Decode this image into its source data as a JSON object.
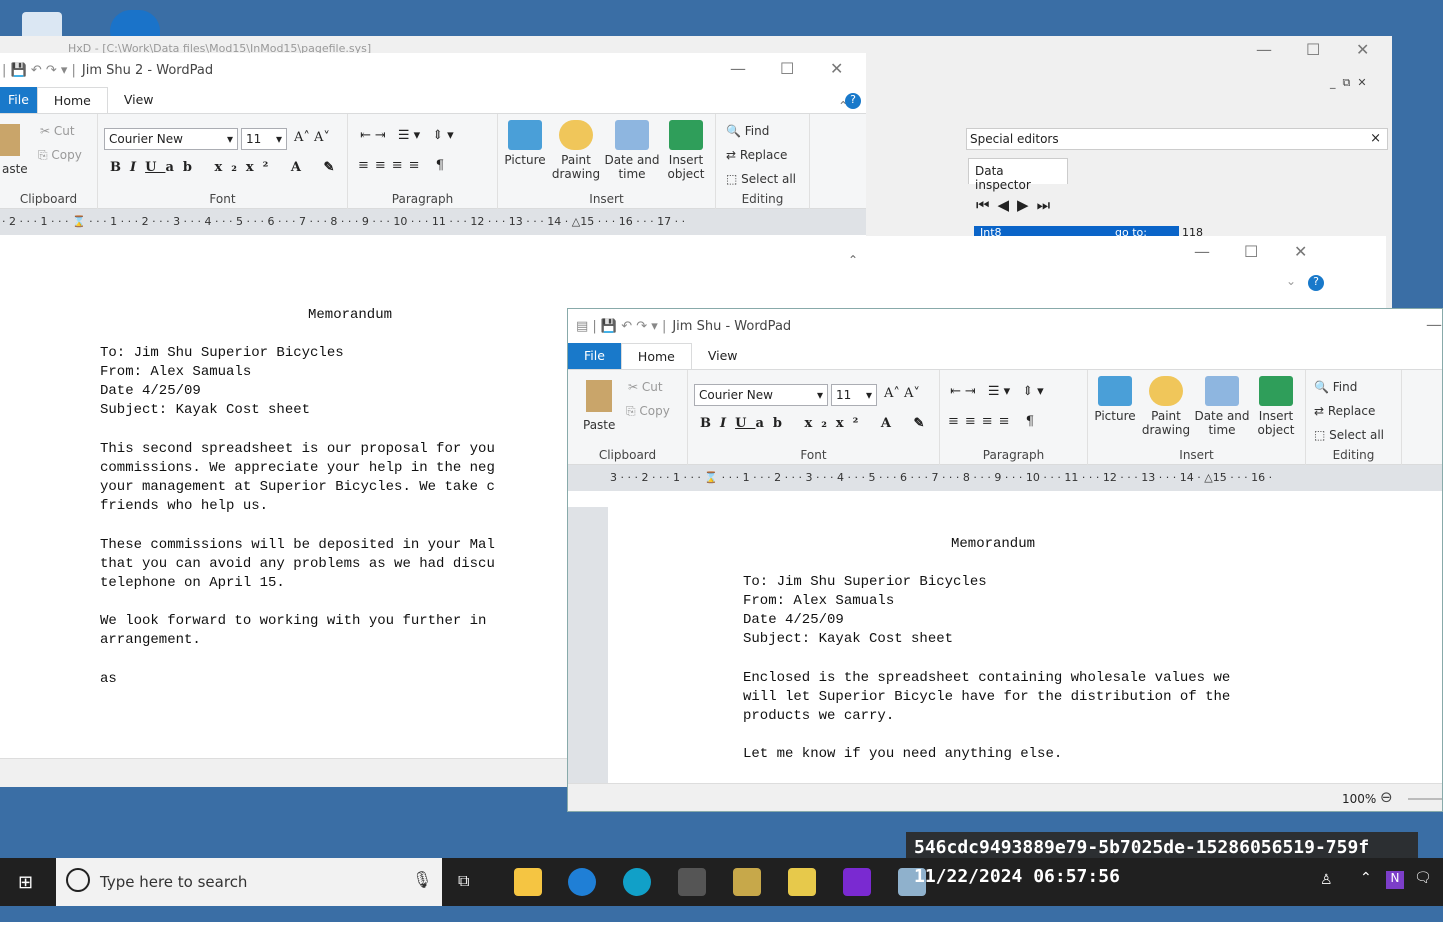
{
  "desktop": {
    "recycle_bin": "Recycle Bin"
  },
  "hxd": {
    "title": "HxD - [C:\\Work\\Data files\\Mod15\\InMod15\\pagefile.sys]",
    "special_editors": "Special editors",
    "data_inspector": "Data inspector",
    "inspector_type": "Int8",
    "inspector_goto": "go to:",
    "inspector_value": "118"
  },
  "wp_back": {
    "title": "Jim Shu 2 - WordPad",
    "tabs": [
      "File",
      "Home",
      "View"
    ],
    "clipboard": {
      "paste": "aste",
      "cut": "Cut",
      "copy": "Copy",
      "label": "Clipboard"
    },
    "font": {
      "name": "Courier New",
      "size": "11",
      "label": "Font"
    },
    "paragraph": {
      "label": "Paragraph"
    },
    "insert": {
      "picture": "Picture",
      "paint": "Paint\ndrawing",
      "datetime": "Date and\ntime",
      "object": "Insert\nobject",
      "label": "Insert"
    },
    "editing": {
      "find": "Find",
      "replace": "Replace",
      "selectall": "Select all",
      "label": "Editing"
    },
    "ruler": "· 2 · · · 1 · · · ⌛ · · · 1 · · · 2 · · · 3 · · · 4 · · · 5 · · · 6 · · · 7 · · · 8 · · · 9 · · · 10 · · · 11 · · · 12 · · · 13 · · · 14 · △15 · · · 16 · · · 17 · ·",
    "doc": {
      "heading": "Memorandum",
      "to": "To: Jim Shu Superior Bicycles",
      "from": "From: Alex Samuals",
      "date": "Date 4/25/09",
      "subject": "Subject: Kayak Cost sheet",
      "p1": "This second spreadsheet is our proposal for you\ncommissions. We appreciate your help in the neg\nyour management at Superior Bicycles. We take c\nfriends who help us.",
      "p2": "These commissions will be deposited in your Mal\nthat you can avoid any problems as we had discu\ntelephone on April 15.",
      "p3": "We look forward to working with you further in\narrangement.",
      "p4": "as"
    }
  },
  "wp_front": {
    "title": "Jim Shu - WordPad",
    "tabs": [
      "File",
      "Home",
      "View"
    ],
    "clipboard": {
      "paste": "Paste",
      "cut": "Cut",
      "copy": "Copy",
      "label": "Clipboard"
    },
    "font": {
      "name": "Courier New",
      "size": "11",
      "label": "Font"
    },
    "paragraph": {
      "label": "Paragraph"
    },
    "insert": {
      "picture": "Picture",
      "paint": "Paint\ndrawing",
      "datetime": "Date and\ntime",
      "object": "Insert\nobject",
      "label": "Insert"
    },
    "editing": {
      "find": "Find",
      "replace": "Replace",
      "selectall": "Select all",
      "label": "Editing"
    },
    "ruler": "3 · · · 2 · · · 1 · · · ⌛ · · · 1 · · · 2 · · · 3 · · · 4 · · · 5 · · · 6 · · · 7 · · · 8 · · · 9 · · · 10 · · · 11 · · · 12 · · · 13 · · · 14 · △15 · · · 16 ·",
    "doc": {
      "heading": "Memorandum",
      "to": "To: Jim Shu Superior Bicycles",
      "from": "From: Alex Samuals",
      "date": "Date 4/25/09",
      "subject": "Subject: Kayak Cost sheet",
      "p1": "Enclosed is the spreadsheet containing wholesale values we\nwill let Superior Bicycle have for the distribution of the\nproducts we carry.",
      "p2": "Let me know if you need anything else."
    },
    "zoom": "100%"
  },
  "overlay": {
    "hash": "546cdc9493889e79-5b7025de-15286056519-759f",
    "datetime": "11/22/2024 06:57:56"
  },
  "taskbar": {
    "search_placeholder": "Type here to search"
  }
}
